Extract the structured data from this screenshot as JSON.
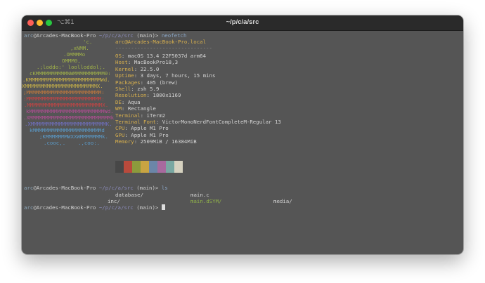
{
  "window": {
    "shortcut": "⌥⌘1",
    "title": "~/p/c/a/src"
  },
  "prompt": {
    "user": "arc",
    "host": "Arcades-MacBook-Pro",
    "path": "~/p/c/a/src",
    "branch": "(main)>"
  },
  "commands": {
    "first": "neofetch",
    "second": "ls"
  },
  "logo": {
    "lines": [
      {
        "text": "'c.",
        "color": "#9fb04a"
      },
      {
        "text": ",xNMM.",
        "color": "#9fb04a"
      },
      {
        "text": ".OMMMMo",
        "color": "#9fb04a"
      },
      {
        "text": "OMMM0,",
        "color": "#9fb04a"
      },
      {
        "text": ".;loddo:' loolloddol;.",
        "color": "#9fb04a"
      },
      {
        "text": "cKMMMMMMMMMMNWMMMMMMMMMM0:",
        "color": "#9fb04a"
      },
      {
        "text": ".KMMMMMMMMMMMMMMMMMMMMMMMWd.",
        "color": "#c9b248"
      },
      {
        "text": "XMMMMMMMMMMMMMMMMMMMMMMMX.",
        "color": "#c9b248"
      },
      {
        "text": ";MMMMMMMMMMMMMMMMMMMMMMMM:",
        "color": "#c57a3c"
      },
      {
        "text": ":MMMMMMMMMMMMMMMMMMMMMMMM:",
        "color": "#c94444"
      },
      {
        "text": ".MMMMMMMMMMMMMMMMMMMMMMMMX.",
        "color": "#c94444"
      },
      {
        "text": "kMMMMMMMMMMMMMMMMMMMMMMMMWd.",
        "color": "#b24e94"
      },
      {
        "text": ".XMMMMMMMMMMMMMMMMMMMMMMMMMMk",
        "color": "#b24e94"
      },
      {
        "text": ".XMMMMMMMMMMMMMMMMMMMMMMMMK.",
        "color": "#7070c0"
      },
      {
        "text": "kMMMMMMMMMMMMMMMMMMMMMMd",
        "color": "#5a9ac8"
      },
      {
        "text": ";KMMMMMMMWXXWMMMMMMMk.",
        "color": "#5a9ac8"
      },
      {
        "text": ".cooc,.    .,coo:.",
        "color": "#5a9ac8"
      }
    ]
  },
  "sysinfo": {
    "header": "arc@Arcades-MacBook-Pro.local",
    "separator": "-------------------------------",
    "rows": [
      {
        "key": "OS",
        "value": "macOS 13.4 22F5037d arm64"
      },
      {
        "key": "Host",
        "value": "MacBookPro18,3"
      },
      {
        "key": "Kernel",
        "value": "22.5.0"
      },
      {
        "key": "Uptime",
        "value": "3 days, 7 hours, 15 mins"
      },
      {
        "key": "Packages",
        "value": "405 (brew)"
      },
      {
        "key": "Shell",
        "value": "zsh 5.9"
      },
      {
        "key": "Resolution",
        "value": "1800x1169"
      },
      {
        "key": "DE",
        "value": "Aqua"
      },
      {
        "key": "WM",
        "value": "Rectangle"
      },
      {
        "key": "Terminal",
        "value": "iTerm2"
      },
      {
        "key": "Terminal Font",
        "value": "VictorMonoNerdFontCompleteM-Regular 13"
      },
      {
        "key": "CPU",
        "value": "Apple M1 Pro"
      },
      {
        "key": "GPU",
        "value": "Apple M1 Pro"
      },
      {
        "key": "Memory",
        "value": "2509MiB / 16384MiB"
      }
    ],
    "palette": [
      "#474747",
      "#b94a3c",
      "#8c9a3c",
      "#c8a442",
      "#6b86a8",
      "#a86a9e",
      "#79a8a2",
      "#d6d2c0"
    ]
  },
  "ls": {
    "items": [
      {
        "text": "database/",
        "color": "#d4d4d4",
        "tail": ""
      },
      {
        "text": "main.c",
        "color": "#d4d4d4",
        "tail": ""
      },
      {
        "text": "inc/",
        "color": "#d4d4d4",
        "tail": ""
      },
      {
        "text": "main.dSYM/",
        "color": "#8fb04a",
        "tail": ""
      },
      {
        "text": "media/",
        "color": "#d4d4d4",
        "tail": ""
      }
    ]
  }
}
